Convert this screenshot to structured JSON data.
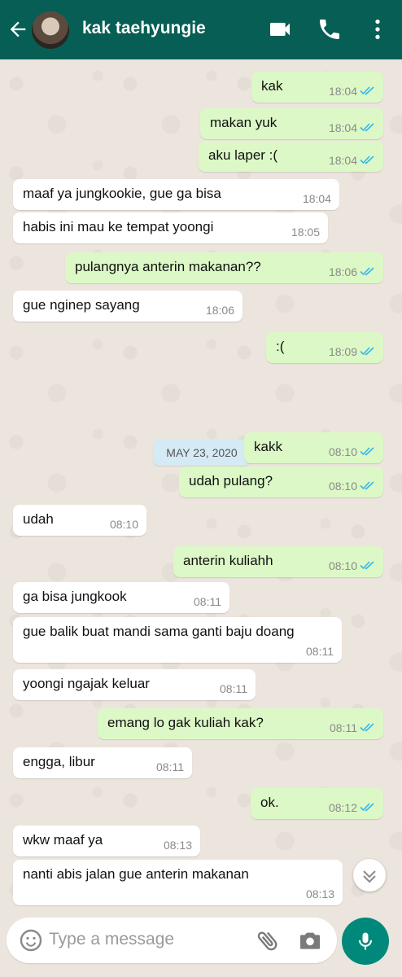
{
  "header": {
    "contact_name": "kak taehyungie",
    "icons": [
      "back-arrow-icon",
      "video-call-icon",
      "phone-icon",
      "more-icon"
    ]
  },
  "messages": [
    {
      "dir": "out",
      "text": "kak",
      "time": "18:04"
    },
    {
      "dir": "out",
      "text": "makan yuk",
      "time": "18:04"
    },
    {
      "dir": "out",
      "text": "aku laper :(",
      "time": "18:04"
    },
    {
      "dir": "in",
      "text": "maaf ya jungkookie,  gue ga bisa",
      "time": "18:04"
    },
    {
      "dir": "in",
      "text": "habis ini mau ke tempat yoongi",
      "time": "18:05"
    },
    {
      "dir": "out",
      "text": "pulangnya anterin makanan??",
      "time": "18:06"
    },
    {
      "dir": "in",
      "text": "gue nginep sayang",
      "time": "18:06"
    },
    {
      "dir": "out",
      "text": ":(",
      "time": "18:09"
    },
    {
      "dir": "out",
      "text": "kakk",
      "time": "08:10"
    },
    {
      "dir": "out",
      "text": "udah pulang?",
      "time": "08:10"
    },
    {
      "dir": "in",
      "text": "udah",
      "time": "08:10"
    },
    {
      "dir": "out",
      "text": "anterin kuliahh",
      "time": "08:10"
    },
    {
      "dir": "in",
      "text": "ga bisa jungkook",
      "time": "08:11"
    },
    {
      "dir": "in",
      "text": "gue balik buat mandi sama ganti baju doang",
      "time": "08:11"
    },
    {
      "dir": "in",
      "text": "yoongi ngajak keluar",
      "time": "08:11"
    },
    {
      "dir": "out",
      "text": "emang lo gak kuliah kak?",
      "time": "08:11"
    },
    {
      "dir": "in",
      "text": "engga, libur",
      "time": "08:11"
    },
    {
      "dir": "out",
      "text": "ok.",
      "time": "08:12"
    },
    {
      "dir": "in",
      "text": "wkw maaf ya",
      "time": "08:13"
    },
    {
      "dir": "in",
      "text": "nanti abis jalan gue anterin makanan",
      "time": "08:13"
    }
  ],
  "date_separator": "MAY 23, 2020",
  "composer": {
    "placeholder": "Type a message"
  },
  "colors": {
    "header": "#075e54",
    "outgoing_bubble": "#dcf8c6",
    "incoming_bubble": "#ffffff",
    "read_tick": "#34b7f1",
    "mic_button": "#00897b"
  }
}
